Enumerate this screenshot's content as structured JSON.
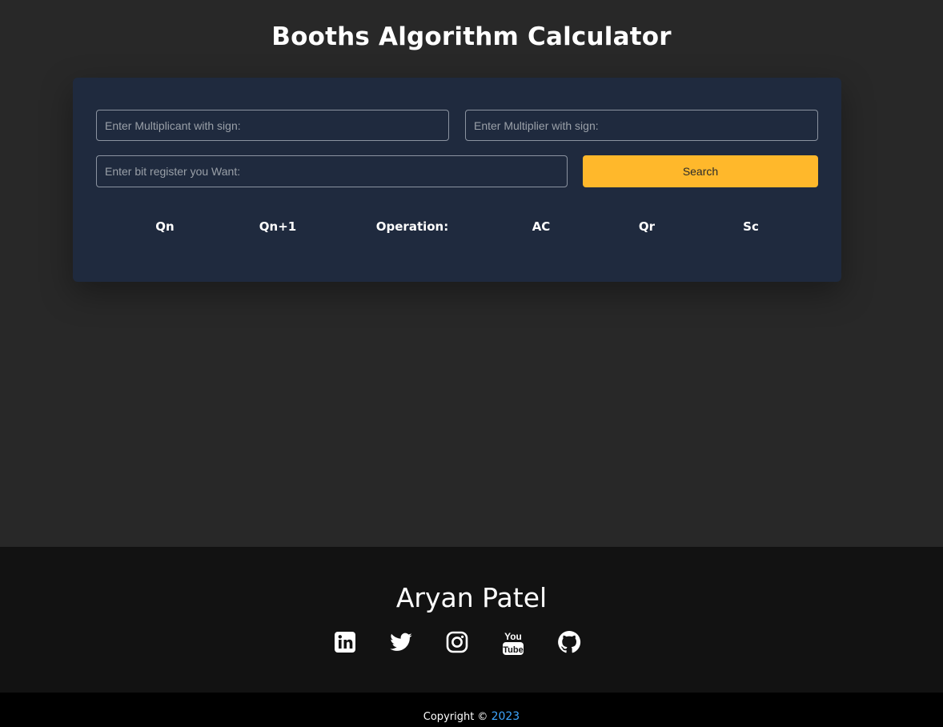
{
  "header": {
    "title": "Booths Algorithm Calculator"
  },
  "form": {
    "multiplicand_placeholder": "Enter Multiplicant with sign:",
    "multiplier_placeholder": "Enter Multiplier with sign:",
    "bits_placeholder": "Enter bit register you Want:",
    "search_label": "Search"
  },
  "table": {
    "columns": [
      "Qn",
      "Qn+1",
      "Operation:",
      "AC",
      "Qr",
      "Sc"
    ]
  },
  "footer": {
    "author": "Aryan Patel",
    "social_icons": [
      "linkedin-icon",
      "twitter-icon",
      "instagram-icon",
      "youtube-icon",
      "github-icon"
    ],
    "copyright_label": "Copyright ©",
    "year": "2023"
  },
  "colors": {
    "background": "#282828",
    "card": "#1f2a3e",
    "accent_button": "#ffb82b",
    "footer": "#121212",
    "copyright_bar": "#000000",
    "year_link": "#3ea6ff"
  }
}
